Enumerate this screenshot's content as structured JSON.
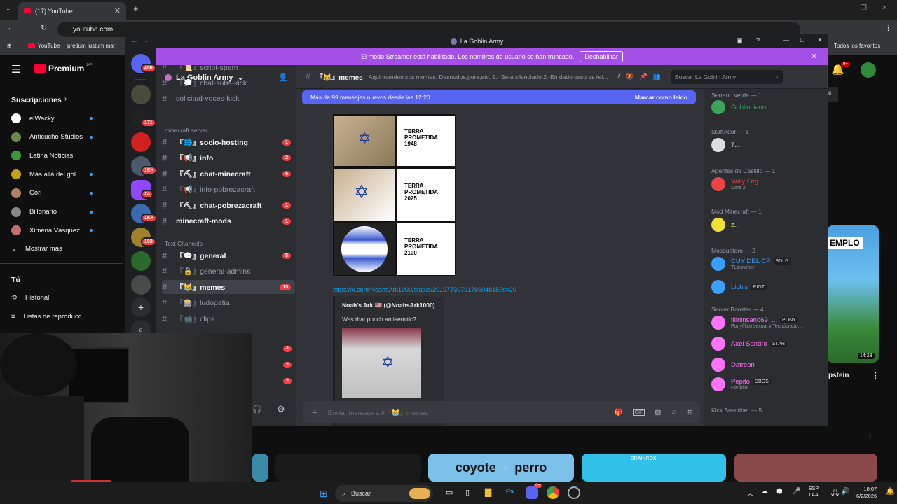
{
  "browser": {
    "tab_title": "(17) YouTube",
    "url": "youtube.com",
    "bookmarks": [
      "YouTube",
      "pretium iustum mar"
    ],
    "all_bookmarks": "Todos los favoritos",
    "colors": {
      "accent": "#ff0033"
    }
  },
  "youtube": {
    "logo": "Premium",
    "logo_sup": "PE",
    "subscriptions_title": "Suscripciones",
    "subscriptions": [
      {
        "name": "elWacky",
        "color": "#ffffff"
      },
      {
        "name": "Anticucho Studios",
        "color": "#6a8a4a"
      },
      {
        "name": "Latina Noticias",
        "color": "#3a9a3a"
      },
      {
        "name": "Más allá del gol",
        "color": "#c4a01a"
      },
      {
        "name": "Cori",
        "color": "#b08060"
      },
      {
        "name": "Billonario",
        "color": "#888888"
      },
      {
        "name": "Ximena Vásquez",
        "color": "#c07070"
      }
    ],
    "show_more": "Mostrar más",
    "you_title": "Tú",
    "you_items": [
      "Historial",
      "Listas de reproducc..."
    ],
    "video_duration": "14:23",
    "video_caption": "pstein",
    "thumb_emplo": "EMPLO",
    "thumb_coyote": "coyote",
    "thumb_plus": "+",
    "thumb_perro": "perro",
    "thumb_brand": "BRAINROX"
  },
  "discord": {
    "window_title": "La Goblin Army",
    "streamer_notice": "El modo Streamer está habilitado. Los nombres de usuario se han truncado.",
    "streamer_button": "Deshabilitar",
    "dm_badge": "450",
    "server_badges": [
      "171",
      "1K+",
      "24",
      "1K+",
      "103"
    ],
    "guild_name": "La Goblin Army",
    "channels_top": [
      {
        "name": "『📜』script-spam",
        "count": ""
      },
      {
        "name": "『💭』chat-subs-kick",
        "count": ""
      },
      {
        "name": "solicitud-voces-kick",
        "count": ""
      }
    ],
    "category_minecraft": "minecraft server",
    "channels_minecraft": [
      {
        "name": "『🌐』socio-hosting",
        "count": "1"
      },
      {
        "name": "『📢』info",
        "count": "2"
      },
      {
        "name": "『⛏』chat-minecraft",
        "count": "5"
      },
      {
        "name": "『📢』info-pobrezacraft",
        "count": ""
      },
      {
        "name": "『⛏』chat-pobrezacraft",
        "count": "1"
      },
      {
        "name": "minecraft-mods",
        "count": "1"
      }
    ],
    "category_text": "Text Channels",
    "channels_text": [
      {
        "name": "『💬』general",
        "count": "5"
      },
      {
        "name": "『🔒』general-admins",
        "count": ""
      },
      {
        "name": "『😹』memes",
        "count": "15"
      },
      {
        "name": "『🎰』ludopatia",
        "count": ""
      },
      {
        "name": "『📹』clips",
        "count": ""
      }
    ],
    "extra_badges": [
      "4",
      "9",
      "9"
    ],
    "current_channel": "『😹』memes",
    "channel_topic": "Aqui manden sus memes. Desnudos,gore,etc. 1.- Sera silenciado 2.-En dado caso es rei...",
    "search_placeholder": "Buscar La Goblin Army",
    "new_messages": "Más de 99 mensajes nuevos desde las 12:20",
    "mark_read": "Marcar como leído",
    "meme_labels": [
      "TERRA PROMETIDA 1948",
      "TERRA PROMETIDA 2025",
      "TERRA PROMETIDA 2100"
    ],
    "link": "https://x.com/NoahsArk1000/status/2019773079178604815?s=20",
    "embed_author": "Noah's Ark 🇺🇸 (@NoahsArk1000)",
    "embed_text": "Was that punch antisemitic?",
    "composer_placeholder": "Enviar mensaje a #『😹』memes",
    "members": [
      {
        "group": "Serrano verde — 1",
        "names": [
          {
            "name": "Goblinciano",
            "color": "#3ba55d",
            "sub": "",
            "tag": ""
          }
        ]
      },
      {
        "group": "StaffAdor — 1",
        "names": [
          {
            "name": "7...",
            "color": "#dbdee1",
            "sub": "",
            "tag": ""
          }
        ]
      },
      {
        "group": "Agentes de Castillo — 1",
        "names": [
          {
            "name": "Willy Fog",
            "color": "#ed4245",
            "sub": "Dota 2",
            "tag": ""
          }
        ]
      },
      {
        "group": "Mod Minecraft — 1",
        "names": [
          {
            "name": "z...",
            "color": "#f0e130",
            "sub": "",
            "tag": ""
          }
        ]
      },
      {
        "group": "Mosquetero — 2",
        "names": [
          {
            "name": "CUY DEL CP",
            "color": "#3aa0ff",
            "sub": "TLauncher",
            "tag": "SDLG"
          },
          {
            "name": "Lichis",
            "color": "#3aa0ff",
            "sub": "",
            "tag": "RIOT"
          }
        ]
      },
      {
        "group": "Server Booster — 4",
        "names": [
          {
            "name": "tilininsano69_...",
            "color": "#ff73fa",
            "sub": "Ponyfilico sexual y Tecnócrata ...",
            "tag": "PONY"
          },
          {
            "name": "Axel Sandro",
            "color": "#ff73fa",
            "sub": "",
            "tag": "STAR"
          },
          {
            "name": "Datreon",
            "color": "#ff73fa",
            "sub": "",
            "tag": ""
          },
          {
            "name": "Pepito",
            "color": "#ff73fa",
            "sub": "Fortnite",
            "tag": "DBGS"
          }
        ]
      },
      {
        "group": "Kick Suscriber — 5",
        "names": []
      }
    ],
    "colors": {
      "streamer": "#a44fe6",
      "blurple": "#5865f2",
      "badge": "#f23f43",
      "link": "#00a8fc"
    }
  },
  "taskbar": {
    "search": "Buscar",
    "lang": "ESP",
    "lang2": "LAA",
    "time": "18:07",
    "date": "6/2/2026",
    "discord_badge": "9+"
  }
}
